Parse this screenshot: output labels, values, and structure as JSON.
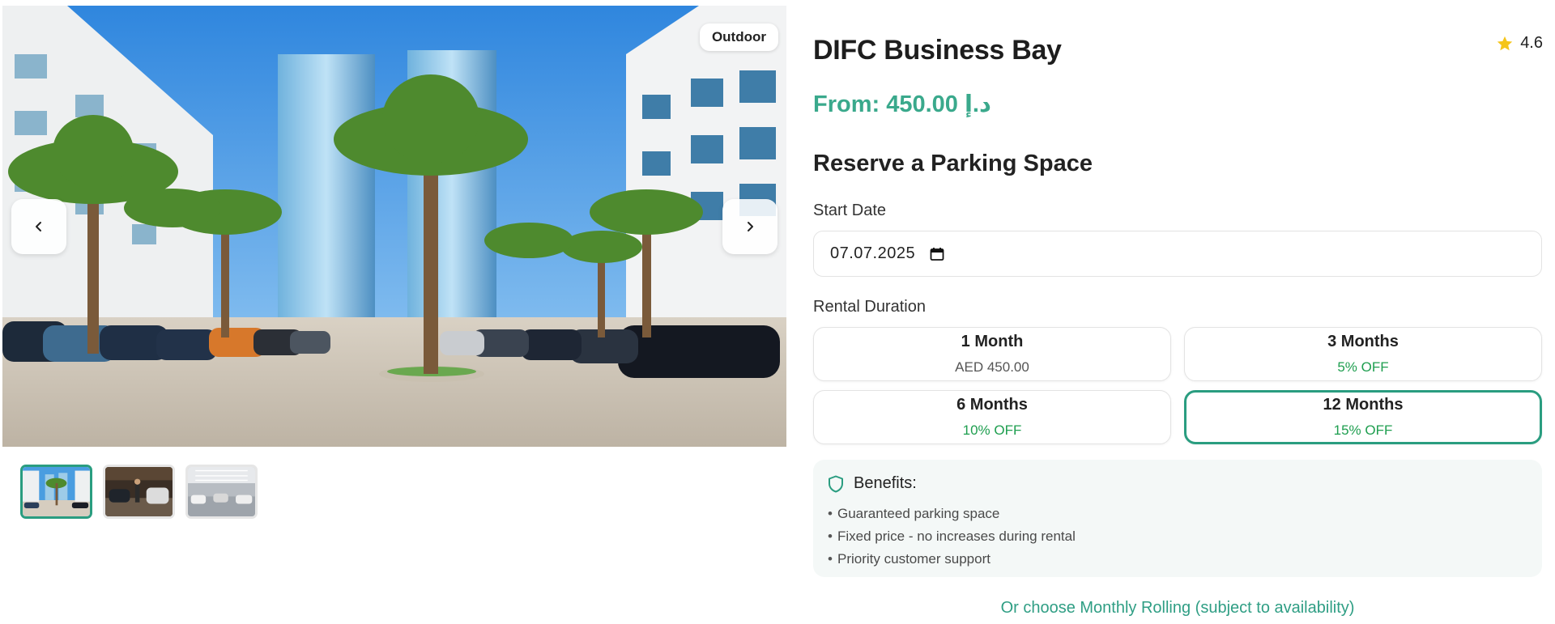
{
  "gallery": {
    "badge": "Outdoor",
    "prev_icon": "chevron-left-icon",
    "next_icon": "chevron-right-icon",
    "thumbnails": [
      "Outdoor palms parking",
      "Garage interior with cars",
      "Indoor parking structure"
    ],
    "active_thumbnail": 0
  },
  "listing": {
    "title": "DIFC Business Bay",
    "rating": "4.6",
    "rating_icon": "star-icon",
    "price": "From: 450.00 د.إ"
  },
  "reserve": {
    "heading": "Reserve a Parking Space",
    "start_date_label": "Start Date",
    "start_date_value": "07.07.2025",
    "calendar_icon": "calendar-icon",
    "duration_label": "Rental Duration",
    "durations": [
      {
        "name": "1 Month",
        "sub": "AED 450.00",
        "discount": false,
        "selected": false
      },
      {
        "name": "3 Months",
        "sub": "5% OFF",
        "discount": true,
        "selected": false
      },
      {
        "name": "6 Months",
        "sub": "10% OFF",
        "discount": true,
        "selected": false
      },
      {
        "name": "12 Months",
        "sub": "15% OFF",
        "discount": true,
        "selected": true
      }
    ]
  },
  "benefits": {
    "icon": "shield-icon",
    "heading": "Benefits:",
    "items": [
      "Guaranteed parking space",
      "Fixed price - no increases during rental",
      "Priority customer support"
    ]
  },
  "rolling_link": "Or choose Monthly Rolling (subject to availability)",
  "colors": {
    "accent": "#2a9d80",
    "price": "#3aa98c",
    "discount": "#1e9e4f",
    "benefits_bg": "#f4f8f7"
  }
}
